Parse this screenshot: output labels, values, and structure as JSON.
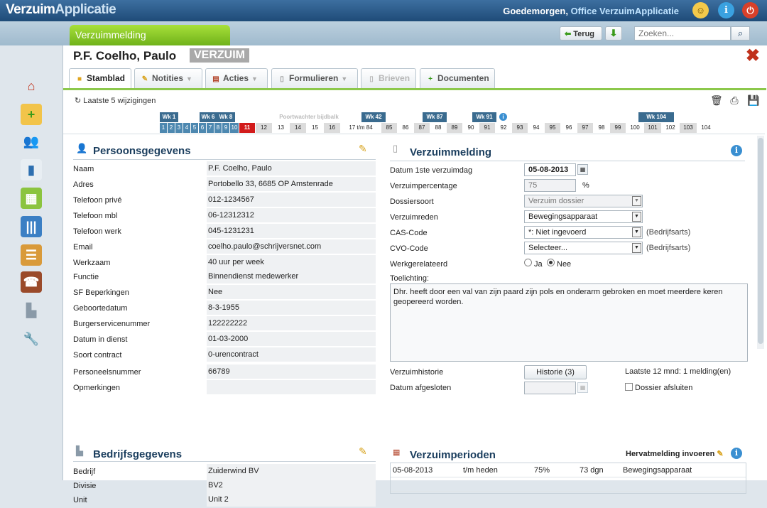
{
  "app": {
    "name_part1": "Verzuim",
    "name_part2": "Applicatie"
  },
  "header": {
    "greeting": "Goedemorgen, ",
    "office": "Office VerzuimApplicatie",
    "user_icon": "user-icon",
    "info_icon": "info-icon",
    "power_icon": "power-icon"
  },
  "subbar": {
    "tab_label": "Verzuimmelding",
    "back_label": "Terug",
    "search_placeholder": "Zoeken..."
  },
  "record": {
    "name": "P.F.  Coelho, Paulo",
    "status_badge": "VERZUIM"
  },
  "tabs": [
    {
      "label": "Stamblad",
      "active": true
    },
    {
      "label": "Notities",
      "dropdown": true
    },
    {
      "label": "Acties",
      "dropdown": true
    },
    {
      "label": "Formulieren",
      "dropdown": true
    },
    {
      "label": "Brieven",
      "disabled": true
    },
    {
      "label": "Documenten"
    }
  ],
  "changes_link": "Laatste 5 wijzigingen",
  "timeline": {
    "week_labels": [
      "Wk 1",
      "Wk 6",
      "Wk 8",
      "Wk 42",
      "Wk 87",
      "Wk 91",
      "Wk 104"
    ],
    "poortwachter": "Poortwachter bijdbalk",
    "numbers": [
      "1",
      "2",
      "3",
      "4",
      "5",
      "6",
      "7",
      "8",
      "9",
      "10",
      "11",
      "12",
      "13",
      "14",
      "15",
      "16",
      "17 t/m 84",
      "85",
      "86",
      "87",
      "88",
      "89",
      "90",
      "91",
      "92",
      "93",
      "94",
      "95",
      "96",
      "97",
      "98",
      "99",
      "100",
      "101",
      "102",
      "103",
      "104"
    ],
    "current": "11"
  },
  "persoon": {
    "title": "Persoonsgegevens",
    "fields": [
      {
        "label": "Naam",
        "value": "P.F. Coelho, Paulo"
      },
      {
        "label": "Adres",
        "value": "Portobello 33, 6685 OP  Amstenrade"
      },
      {
        "label": "Telefoon privé",
        "value": "012-1234567"
      },
      {
        "label": "Telefoon mbl",
        "value": "06-12312312"
      },
      {
        "label": "Telefoon werk",
        "value": "045-1231231"
      },
      {
        "label": "Email",
        "value": "coelho.paulo@schrijversnet.com"
      },
      {
        "label": "Werkzaam",
        "value": "40 uur per week"
      },
      {
        "label": "Functie",
        "value": "Binnendienst medewerker"
      },
      {
        "label": "SF Beperkingen",
        "value": "Nee"
      },
      {
        "label": "Geboortedatum",
        "value": "8-3-1955"
      },
      {
        "label": "Burgerservicenummer",
        "value": "122222222"
      },
      {
        "label": "Datum in dienst",
        "value": "01-03-2000"
      },
      {
        "label": "Soort contract",
        "value": "0-urencontract"
      },
      {
        "label": "Personeelsnummer",
        "value": "66789"
      },
      {
        "label": "Opmerkingen",
        "value": ""
      }
    ]
  },
  "bedrijf": {
    "title": "Bedrijfsgegevens",
    "fields": [
      {
        "label": "Bedrijf",
        "value": "Zuiderwind BV"
      },
      {
        "label": "Divisie",
        "value": "BV2"
      },
      {
        "label": "Unit",
        "value": "Unit 2"
      }
    ]
  },
  "melding": {
    "title": "Verzuimmelding",
    "datum_label": "Datum 1ste verzuimdag",
    "datum_value": "05-08-2013",
    "pct_label": "Verzuimpercentage",
    "pct_value": "75",
    "pct_unit": "%",
    "dossier_label": "Dossiersoort",
    "dossier_value": "Verzuim dossier",
    "reden_label": "Verzuimreden",
    "reden_value": "Bewegingsapparaat",
    "cas_label": "CAS-Code",
    "cas_value": "*: Niet ingevoerd",
    "cas_note": "(Bedrijfsarts)",
    "cvo_label": "CVO-Code",
    "cvo_value": "Selecteer...",
    "cvo_note": "(Bedrijfsarts)",
    "werk_label": "Werkgerelateerd",
    "ja": "Ja",
    "nee": "Nee",
    "toel_label": "Toelichting:",
    "toel_value": "Dhr. heeft door een val van zijn paard zijn pols en onderarm gebroken en moet meerdere keren geopereerd worden.",
    "hist_label": "Verzuimhistorie",
    "hist_button": "Historie (3)",
    "hist_summary": "Laatste 12 mnd: 1 melding(en)",
    "afgesl_label": "Datum afgesloten",
    "afsluiten_label": "Dossier afsluiten"
  },
  "perioden": {
    "title": "Verzuimperioden",
    "hervat": "Hervatmelding invoeren",
    "rows": [
      {
        "start": "05-08-2013",
        "end": "t/m heden",
        "pct": "75%",
        "days": "73 dgn",
        "reason": "Bewegingsapparaat"
      }
    ]
  },
  "colors": {
    "accent_green": "#8cc84b",
    "header_blue": "#2b5a88",
    "alert_red": "#d21b1b"
  }
}
